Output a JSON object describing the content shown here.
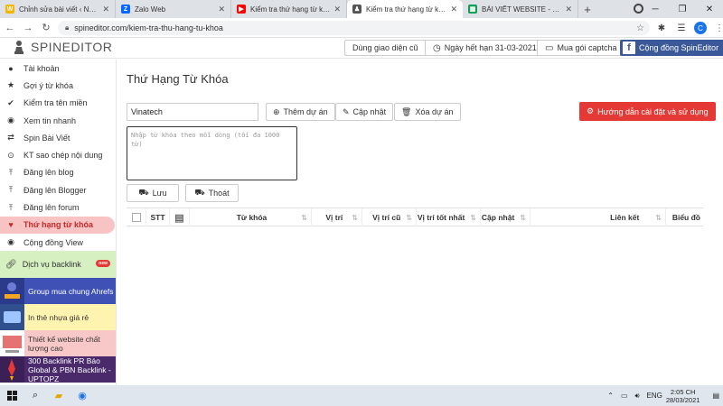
{
  "browser": {
    "tabs": [
      {
        "title": "Chỉnh sửa bài viết ‹ Nội Dung",
        "icon": "wordpress-icon",
        "color": "#f4b400"
      },
      {
        "title": "Zalo Web",
        "icon": "zalo-icon",
        "color": "#0068ff"
      },
      {
        "title": "Kiểm tra thứ hạng từ khóa c",
        "icon": "youtube-icon",
        "color": "#ff0000"
      },
      {
        "title": "Kiểm tra thứ hạng từ khóa",
        "icon": "spineditor-icon",
        "color": "#555555",
        "active": true
      },
      {
        "title": "BÀI VIẾT WEBSITE - Google S",
        "icon": "sheets-icon",
        "color": "#0f9d58"
      }
    ],
    "new_tab": "+",
    "url": "spineditor.com/kiem-tra-thu-hang-tu-khoa",
    "avatar_letter": "C"
  },
  "header": {
    "logo_text": "SPINEDITOR",
    "old_ui_button": "Dùng giao diện cũ",
    "expiry": "Ngày hết hạn 31-03-2021",
    "captcha_button": "Mua gói captcha",
    "community_button": "Cộng đồng SpinEditor"
  },
  "sidebar": {
    "items": [
      {
        "label": "Tài khoản",
        "icon": "user-icon"
      },
      {
        "label": "Gợi ý từ khóa",
        "icon": "star-icon"
      },
      {
        "label": "Kiểm tra tên miền",
        "icon": "check-icon"
      },
      {
        "label": "Xem tin nhanh",
        "icon": "eye-icon"
      },
      {
        "label": "Spin Bài Viết",
        "icon": "shuffle-icon"
      },
      {
        "label": "KT sao chép nội dung",
        "icon": "copy-icon"
      },
      {
        "label": "Đăng lên blog",
        "icon": "upload-icon"
      },
      {
        "label": "Đăng lên Blogger",
        "icon": "upload-icon"
      },
      {
        "label": "Đăng lên forum",
        "icon": "upload-icon"
      },
      {
        "label": "Thứ hạng từ khóa",
        "icon": "heart-icon",
        "active": true
      },
      {
        "label": "Cộng đồng View",
        "icon": "eye-icon"
      }
    ],
    "backlink": {
      "label": "Dịch vụ backlink",
      "badge": "new"
    },
    "banners": [
      {
        "text": "Group mua chung Ahrefs"
      },
      {
        "text": "In thẻ nhựa giá rẻ"
      },
      {
        "text": "Thiết kế website chất lượng cao"
      },
      {
        "text": "300 Backlink PR Báo Global & PBN Backlink - UPTOPZ"
      }
    ]
  },
  "main": {
    "title": "Thứ Hạng Từ Khóa",
    "project_value": "Vinatech",
    "add_project": "Thêm dự án",
    "update": "Cập nhật",
    "delete_project": "Xóa dự án",
    "guide": "Hướng dẫn cài đặt và sử dụng",
    "keywords_placeholder": "Nhập từ khóa theo mỗi dòng (tối đa 1000 từ)",
    "save": "Lưu",
    "exit": "Thoát",
    "columns": [
      "STT",
      "Từ khóa",
      "Vị trí",
      "Vị trí cũ",
      "Vị trí tốt nhất",
      "Cập nhật",
      "Liên kết",
      "Biểu đồ"
    ]
  },
  "taskbar": {
    "lang": "ENG",
    "time": "2:05 CH",
    "date": "28/03/2021"
  }
}
